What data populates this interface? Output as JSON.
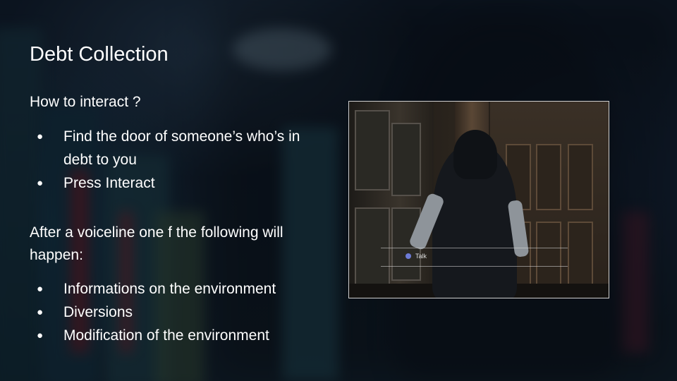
{
  "title": "Debt Collection",
  "question": "How to interact ?",
  "steps": [
    "Find the door of someone’s who’s in debt to you",
    "Press Interact"
  ],
  "after_text": "After a voiceline one f the following will happen:",
  "outcomes": [
    "Informations on the environment",
    "Diversions",
    "Modification of the environment"
  ],
  "bullet": "●",
  "screenshot": {
    "prompt_label": "Talk",
    "prompt_icon": "controller-button-icon"
  }
}
